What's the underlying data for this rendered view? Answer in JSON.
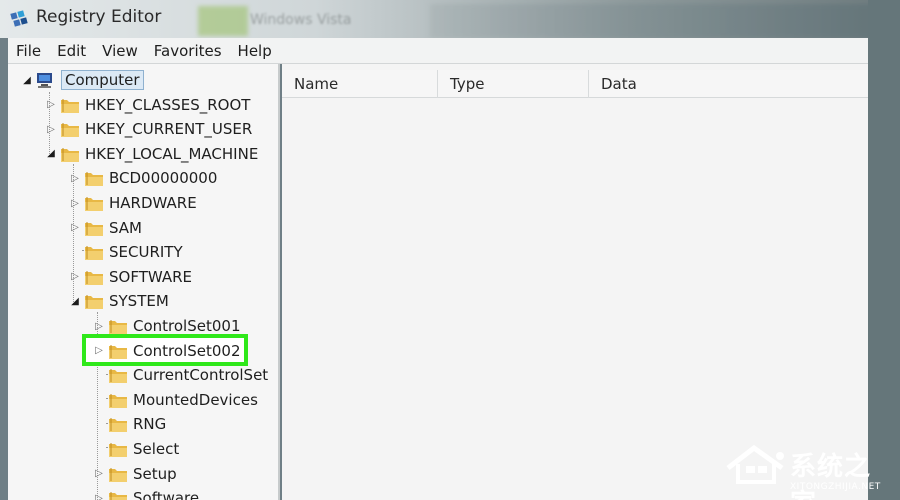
{
  "window": {
    "title": "Registry Editor",
    "background_window_title": "Windows Vista"
  },
  "menu": [
    "File",
    "Edit",
    "View",
    "Favorites",
    "Help"
  ],
  "tree": [
    {
      "label": "Computer",
      "expander": "open",
      "icon": "computer-icon"
    },
    {
      "label": "HKEY_CLASSES_ROOT",
      "expander": "closed",
      "icon": "folder-icon"
    },
    {
      "label": "HKEY_CURRENT_USER",
      "expander": "closed",
      "icon": "folder-icon"
    },
    {
      "label": "HKEY_LOCAL_MACHINE",
      "expander": "open",
      "icon": "folder-icon"
    },
    {
      "label": "BCD00000000",
      "expander": "closed",
      "icon": "folder-icon"
    },
    {
      "label": "HARDWARE",
      "expander": "closed",
      "icon": "folder-icon"
    },
    {
      "label": "SAM",
      "expander": "closed",
      "icon": "folder-icon"
    },
    {
      "label": "SECURITY",
      "expander": "none",
      "icon": "folder-icon"
    },
    {
      "label": "SOFTWARE",
      "expander": "closed",
      "icon": "folder-icon"
    },
    {
      "label": "SYSTEM",
      "expander": "open",
      "icon": "folder-icon"
    },
    {
      "label": "ControlSet001",
      "expander": "closed",
      "icon": "folder-icon"
    },
    {
      "label": "ControlSet002",
      "expander": "closed",
      "icon": "folder-icon",
      "highlighted": true
    },
    {
      "label": "CurrentControlSet",
      "expander": "none",
      "icon": "folder-icon"
    },
    {
      "label": "MountedDevices",
      "expander": "none",
      "icon": "folder-icon"
    },
    {
      "label": "RNG",
      "expander": "none",
      "icon": "folder-icon"
    },
    {
      "label": "Select",
      "expander": "none",
      "icon": "folder-icon"
    },
    {
      "label": "Setup",
      "expander": "closed",
      "icon": "folder-icon"
    },
    {
      "label": "Software",
      "expander": "closed",
      "icon": "folder-icon"
    }
  ],
  "columns": [
    "Name",
    "Type",
    "Data"
  ],
  "watermark": {
    "text": "系统之家",
    "sub": "XITONGZHIJIA.NET"
  },
  "colors": {
    "highlight": "#2fe81a",
    "folder": "#e8b845",
    "selection": "#dce9f5"
  }
}
